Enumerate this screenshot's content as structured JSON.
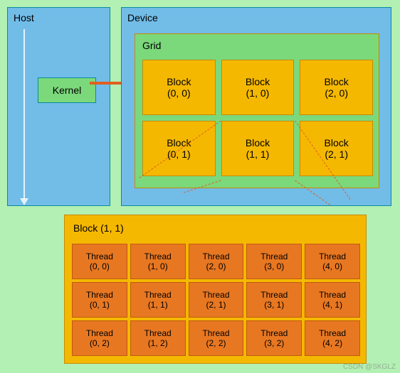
{
  "host": {
    "title": "Host"
  },
  "device": {
    "title": "Device"
  },
  "kernel": {
    "label": "Kernel"
  },
  "grid": {
    "title": "Grid",
    "blocks": [
      {
        "label": "Block",
        "coord": "(0, 0)"
      },
      {
        "label": "Block",
        "coord": "(1, 0)"
      },
      {
        "label": "Block",
        "coord": "(2, 0)"
      },
      {
        "label": "Block",
        "coord": "(0, 1)"
      },
      {
        "label": "Block",
        "coord": "(1, 1)"
      },
      {
        "label": "Block",
        "coord": "(2, 1)"
      }
    ]
  },
  "block_detail": {
    "title": "Block (1, 1)",
    "threads": [
      {
        "label": "Thread",
        "coord": "(0, 0)"
      },
      {
        "label": "Thread",
        "coord": "(1, 0)"
      },
      {
        "label": "Thread",
        "coord": "(2, 0)"
      },
      {
        "label": "Thread",
        "coord": "(3, 0)"
      },
      {
        "label": "Thread",
        "coord": "(4, 0)"
      },
      {
        "label": "Thread",
        "coord": "(0, 1)"
      },
      {
        "label": "Thread",
        "coord": "(1, 1)"
      },
      {
        "label": "Thread",
        "coord": "(2, 1)"
      },
      {
        "label": "Thread",
        "coord": "(3, 1)"
      },
      {
        "label": "Thread",
        "coord": "(4, 1)"
      },
      {
        "label": "Thread",
        "coord": "(0, 2)"
      },
      {
        "label": "Thread",
        "coord": "(1, 2)"
      },
      {
        "label": "Thread",
        "coord": "(2, 2)"
      },
      {
        "label": "Thread",
        "coord": "(3, 2)"
      },
      {
        "label": "Thread",
        "coord": "(4, 2)"
      }
    ]
  },
  "watermark": "CSDN @SKGLZ"
}
